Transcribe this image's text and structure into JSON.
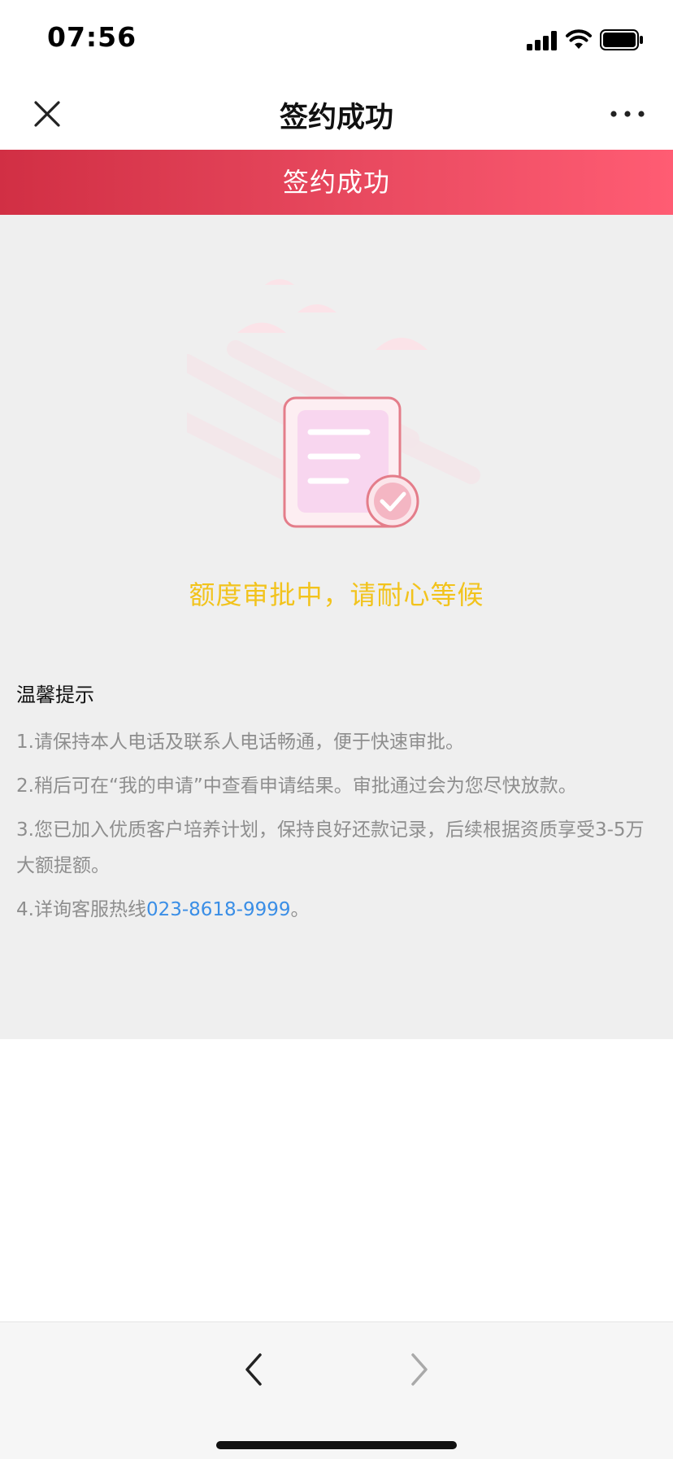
{
  "status_bar": {
    "time": "07:56"
  },
  "nav": {
    "title": "签约成功"
  },
  "banner": {
    "title": "签约成功"
  },
  "main": {
    "status_message": "额度审批中，请耐心等候",
    "tips_title": "温馨提示",
    "tips": [
      "1.请保持本人电话及联系人电话畅通，便于快速审批。",
      "2.稍后可在“我的申请”中查看申请结果。审批通过会为您尽快放款。",
      "3.您已加入优质客户培养计划，保持良好还款记录，后续根据资质享受3-5万大额提额。"
    ],
    "tip4_prefix": "4.详询客服热线",
    "hotline": "023-8618-9999",
    "tip4_suffix": "。"
  },
  "colors": {
    "accent": "#e94a60",
    "status_message": "#f2c31c",
    "link": "#3a8ee6"
  },
  "icons": [
    "close-icon",
    "more-icon",
    "document-check-icon",
    "back-arrow-icon",
    "forward-arrow-icon"
  ]
}
